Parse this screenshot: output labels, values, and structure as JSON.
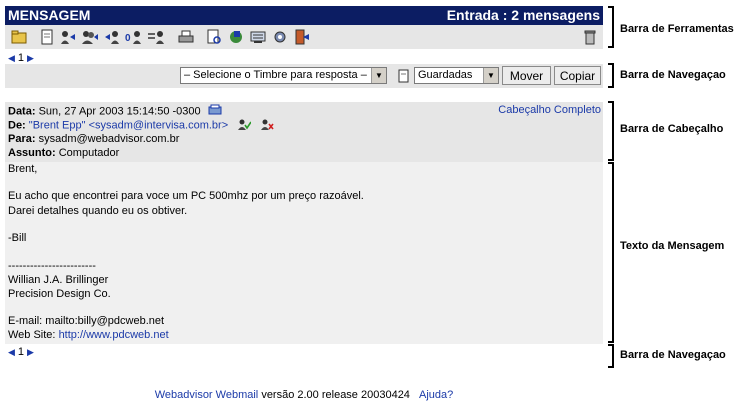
{
  "title_bar": {
    "app_title": "MENSAGEM",
    "folder_status": "Entrada : 2 mensagens"
  },
  "toolbar": {
    "icons": [
      "folder-icon",
      "compose-icon",
      "reply-icon",
      "reply-all-icon",
      "forward-icon",
      "forward-as-attachment-icon",
      "redirect-icon",
      "print-icon",
      "view-source-icon",
      "save-icon",
      "addresses-icon",
      "filter-icon",
      "exit-icon",
      "trash-icon"
    ]
  },
  "pager_top": {
    "page": "1"
  },
  "pager_bottom": {
    "page": "1"
  },
  "nav": {
    "stationery_select": "– Selecione o Timbre para resposta –",
    "folder_select": "Guardadas",
    "move_label": "Mover",
    "copy_label": "Copiar"
  },
  "header": {
    "date_label": "Data:",
    "date_value": "Sun, 27 Apr 2003 15:14:50 -0300",
    "full_header_link": "Cabeçalho Completo",
    "from_label": "De:",
    "from_value": "\"Brent Epp\" <sysadm@intervisa.com.br>",
    "to_label": "Para:",
    "to_value": "sysadm@webadvisor.com.br",
    "subject_label": "Assunto:",
    "subject_value": "Computador"
  },
  "body": {
    "greeting": "Brent,",
    "line1": "Eu acho que encontrei para voce um PC 500mhz por um preço razoável.",
    "line2": "Darei detalhes quando eu os obtiver.",
    "sign": "-Bill",
    "separator": "------------------------",
    "sig_name": "Willian J.A. Brillinger",
    "sig_company": "Precision Design Co.",
    "sig_email": "E-mail: mailto:billy@pdcweb.net",
    "sig_web_label": "Web Site:",
    "sig_web_url": "http://www.pdcweb.net"
  },
  "footer": {
    "product_link": "Webadvisor Webmail",
    "version": "versão 2.00 release 20030424",
    "help_link": "Ajuda?"
  },
  "annotations": {
    "toolbar": "Barra de Ferramentas",
    "nav_top": "Barra de Navegaçao",
    "header": "Barra de Cabeçalho",
    "body": "Texto da Mensagem",
    "nav_bottom": "Barra de Navegaçao"
  },
  "colors": {
    "title_bar": "#0c1d63",
    "link": "#1b3aa8",
    "panel": "#e6e6e6"
  }
}
